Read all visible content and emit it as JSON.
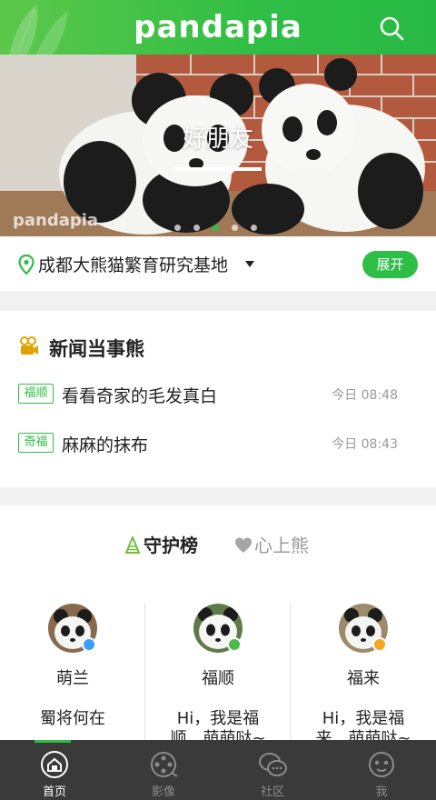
{
  "app": {
    "logo": "pandapia"
  },
  "colors": {
    "brand_green": "#2fbe45",
    "nav_bg": "#3a3a3a",
    "muted": "#9a9a9a"
  },
  "banner": {
    "caption": "好朋友",
    "watermark": "pandapia",
    "slide_count": 5,
    "active_slide": 3
  },
  "location": {
    "name": "成都大熊猫繁育研究基地",
    "expand_label": "展开"
  },
  "news": {
    "title": "新闻当事熊",
    "items": [
      {
        "tag": "福顺",
        "text": "看看奇家的毛发真白",
        "time": "今日 08:48"
      },
      {
        "tag": "奇福",
        "text": "麻麻的抹布",
        "time": "今日 08:43"
      }
    ]
  },
  "tabs": {
    "guard": "守护榜",
    "heart": "心上熊"
  },
  "pandas": [
    {
      "name": "萌兰",
      "desc": "蜀将何在",
      "badge_color": "#3aa0ff"
    },
    {
      "name": "福顺",
      "desc": "Hi，我是福顺，萌萌哒~",
      "badge_color": "#4cbb4a"
    },
    {
      "name": "福来",
      "desc": "Hi，我是福来，萌萌哒~",
      "badge_color": "#f5a623"
    }
  ],
  "nav": {
    "items": [
      {
        "label": "首页",
        "icon": "home-icon"
      },
      {
        "label": "影像",
        "icon": "film-reel-icon"
      },
      {
        "label": "社区",
        "icon": "chat-bubbles-icon"
      },
      {
        "label": "我",
        "icon": "panda-profile-icon"
      }
    ],
    "active": 0
  }
}
